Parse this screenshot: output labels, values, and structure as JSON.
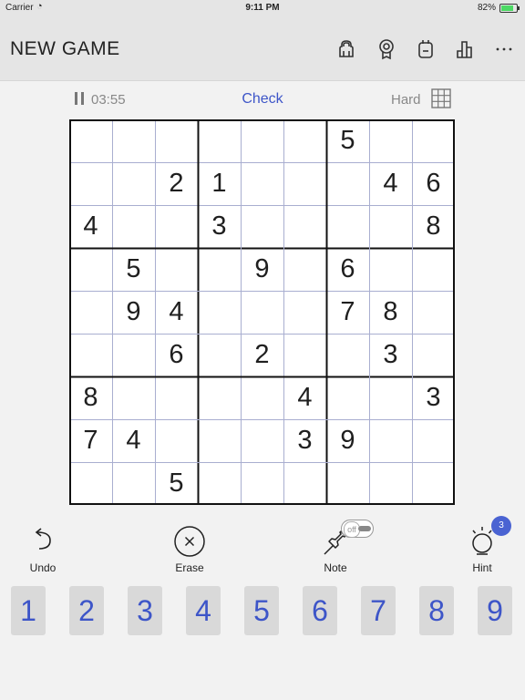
{
  "status_bar": {
    "carrier": "Carrier",
    "time": "9:11 PM",
    "battery_percent": "82%",
    "battery_level": 0.82
  },
  "navbar": {
    "title": "NEW GAME",
    "icons": [
      "store-icon",
      "achievement-icon",
      "daily-challenge-icon",
      "statistics-icon",
      "more-icon"
    ]
  },
  "game_info": {
    "timer": "03:55",
    "check_label": "Check",
    "difficulty": "Hard"
  },
  "board": {
    "grid": [
      [
        0,
        0,
        0,
        0,
        0,
        0,
        5,
        0,
        0
      ],
      [
        0,
        0,
        2,
        1,
        0,
        0,
        0,
        4,
        6
      ],
      [
        4,
        0,
        0,
        3,
        0,
        0,
        0,
        0,
        8
      ],
      [
        0,
        5,
        0,
        0,
        9,
        0,
        6,
        0,
        0
      ],
      [
        0,
        9,
        4,
        0,
        0,
        0,
        7,
        8,
        0
      ],
      [
        0,
        0,
        6,
        0,
        2,
        0,
        0,
        3,
        0
      ],
      [
        8,
        0,
        0,
        0,
        0,
        4,
        0,
        0,
        3
      ],
      [
        7,
        4,
        0,
        0,
        0,
        3,
        9,
        0,
        0
      ],
      [
        0,
        0,
        5,
        0,
        0,
        0,
        0,
        0,
        0
      ]
    ]
  },
  "tools": {
    "undo": {
      "label": "Undo"
    },
    "erase": {
      "label": "Erase"
    },
    "note": {
      "label": "Note",
      "toggle_state": "off"
    },
    "hint": {
      "label": "Hint",
      "count": "3"
    }
  },
  "number_pad": [
    "1",
    "2",
    "3",
    "4",
    "5",
    "6",
    "7",
    "8",
    "9"
  ],
  "colors": {
    "accent": "#3d55c8",
    "badge": "#4a63d2",
    "bar_bg": "#e5e5e5",
    "key_bg": "#d9d9d9",
    "background": "#f2f2f2"
  }
}
